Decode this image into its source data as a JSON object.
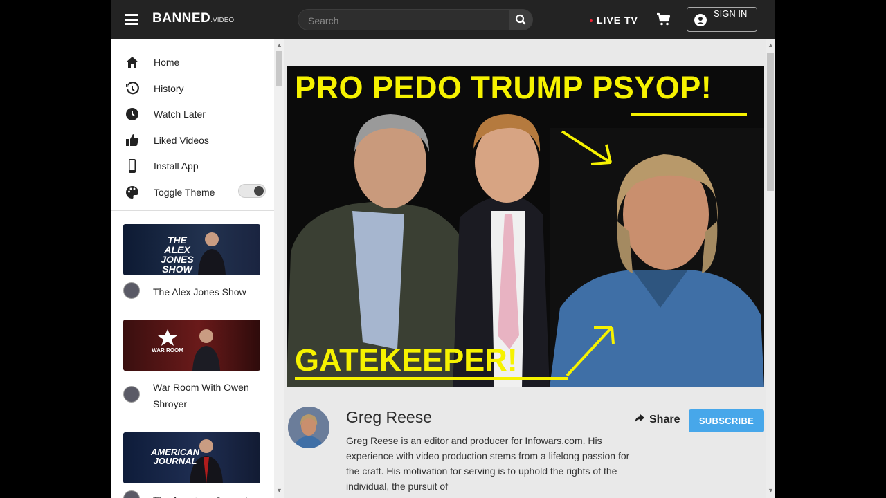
{
  "header": {
    "logo_main": "BANNED",
    "logo_suffix": ".VIDEO",
    "search_placeholder": "Search",
    "live_tv_label": "LIVE TV",
    "sign_in_label": "SIGN IN"
  },
  "sidebar": {
    "nav": [
      {
        "label": "Home",
        "icon": "home-icon"
      },
      {
        "label": "History",
        "icon": "history-icon"
      },
      {
        "label": "Watch Later",
        "icon": "clock-icon"
      },
      {
        "label": "Liked Videos",
        "icon": "thumbs-up-icon"
      },
      {
        "label": "Install App",
        "icon": "phone-icon"
      },
      {
        "label": "Toggle Theme",
        "icon": "palette-icon"
      }
    ],
    "shows": [
      {
        "thumb_title": "THE ALEX JONES SHOW",
        "name": "The Alex Jones Show"
      },
      {
        "thumb_title": "WAR ROOM",
        "name": "War Room With Owen Shroyer"
      },
      {
        "thumb_title": "AMERICAN JOURNAL",
        "name": "The American Journal"
      }
    ]
  },
  "video": {
    "headline_part1": "PRO PEDO TRUMP ",
    "headline_part2": "PSYOP!",
    "caption": "GATEKEEPER!"
  },
  "channel": {
    "name": "Greg Reese",
    "share_label": "Share",
    "subscribe_label": "SUBSCRIBE",
    "description": "Greg Reese is an editor and producer for Infowars.com. His experience with video production stems from a lifelong passion for the craft. His motivation for serving is to uphold the rights of the individual, the pursuit of"
  },
  "colors": {
    "topbar": "#232323",
    "accent_yellow": "#f6f200",
    "subscribe_blue": "#47a7ea"
  }
}
